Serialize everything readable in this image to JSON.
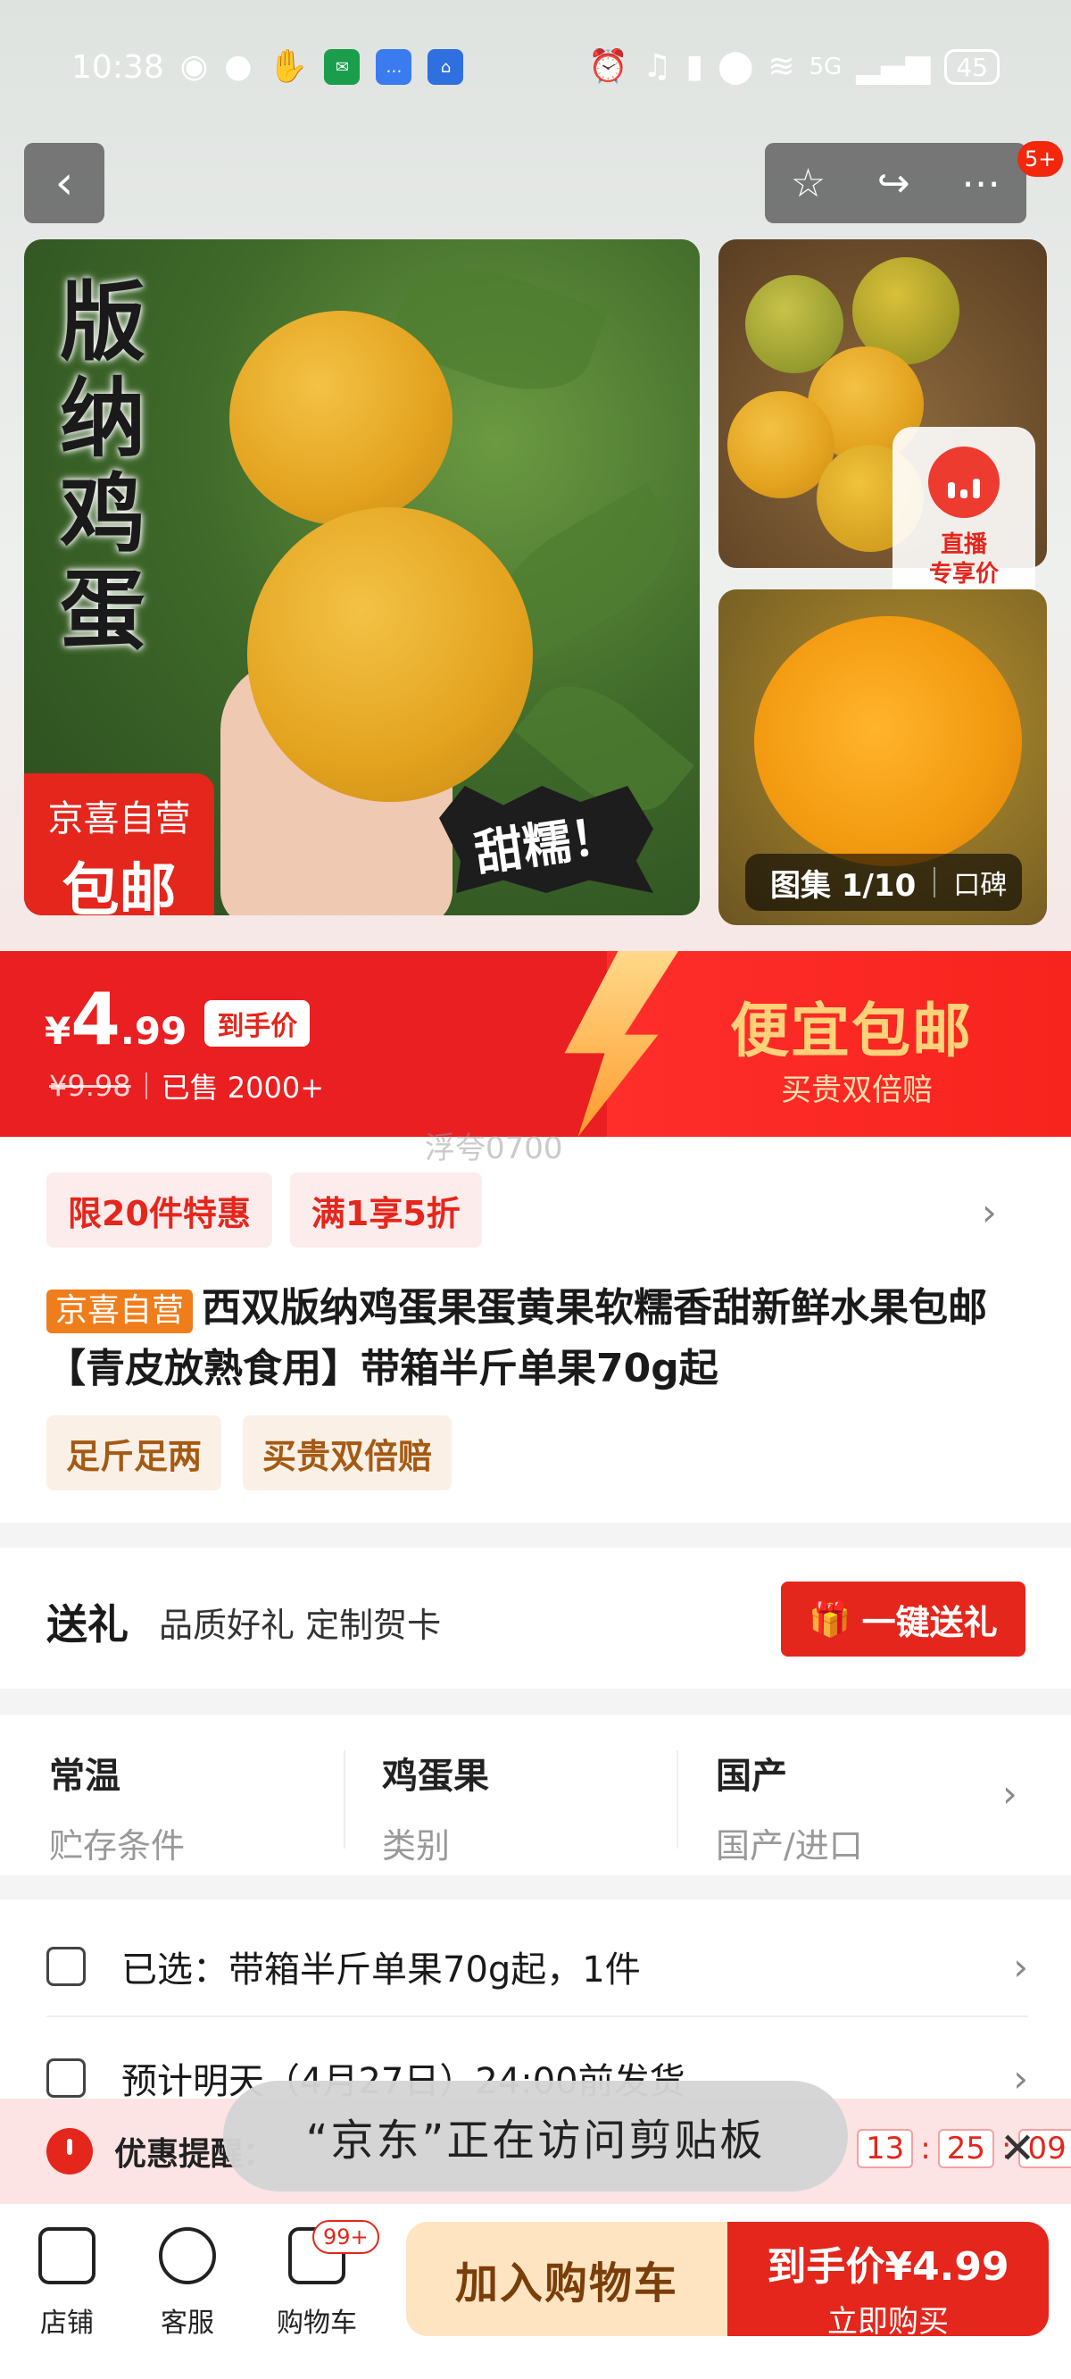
{
  "status_bar": {
    "time": "10:38",
    "network": "5G",
    "battery": "45"
  },
  "nav": {
    "badge": "5+"
  },
  "gallery": {
    "main_title": "版纳鸡蛋",
    "seller_tag_line1": "京喜自营",
    "seller_tag_line2": "包邮",
    "burst_text": "甜糯！",
    "live_line1": "直播",
    "live_line2": "专享价",
    "album_label": "图集 1/10",
    "reviews_label": "口碑"
  },
  "price": {
    "currency": "¥",
    "integer": "4",
    "decimal": ".99",
    "label": "到手价",
    "original": "¥9.98",
    "sold": "已售 2000+",
    "promo_title": "便宜包邮",
    "promo_sub": "买贵双倍赔"
  },
  "watermark": "浮夸0700",
  "info": {
    "coupons": [
      "限20件特惠",
      "满1享5折"
    ],
    "title_tag": "京喜自营",
    "title": "西双版纳鸡蛋果蛋黄果软糯香甜新鲜水果包邮【青皮放熟食用】带箱半斤单果70g起",
    "features": [
      "足斤足两",
      "买贵双倍赔"
    ]
  },
  "gift": {
    "title": "送礼",
    "subtitle": "品质好礼 定制贺卡",
    "button": "一键送礼"
  },
  "specs": [
    {
      "value": "常温",
      "key": "贮存条件"
    },
    {
      "value": "鸡蛋果",
      "key": "类别"
    },
    {
      "value": "国产",
      "key": "国产/进口"
    }
  ],
  "selection": {
    "selected": "已选：带箱半斤单果70g起，1件",
    "shipping": "预计明天（4月27日）24:00前发货"
  },
  "reminder": {
    "text": "优惠提醒：",
    "timer_h": "13",
    "timer_m": "25",
    "timer_s": "09"
  },
  "toast": "“京东”正在访问剪贴板",
  "bottom": {
    "shop": "店铺",
    "service": "客服",
    "cart": "购物车",
    "cart_badge": "99+",
    "add_to_cart": "加入购物车",
    "buy_line1": "到手价¥4.99",
    "buy_line2": "立即购买"
  },
  "colors": {
    "brand_red": "#e4261c",
    "promo_gold": "#ffd27a",
    "tag_orange": "#ef7d1b"
  }
}
